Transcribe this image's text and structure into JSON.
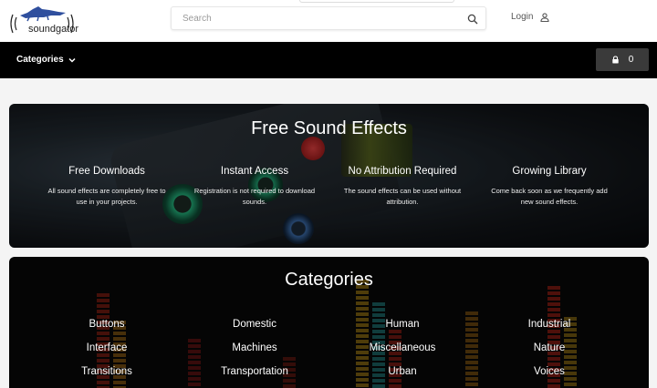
{
  "header": {
    "logo_text": "soundgator",
    "search_placeholder": "Search",
    "login_label": "Login"
  },
  "nav": {
    "categories_label": "Categories",
    "cart_count": "0"
  },
  "hero": {
    "title": "Free Sound Effects",
    "features": [
      {
        "title": "Free Downloads",
        "desc": "All sound effects are completely free to use in your projects."
      },
      {
        "title": "Instant Access",
        "desc": "Registration is not required to download sounds."
      },
      {
        "title": "No Attribution Required",
        "desc": "The sound effects can be used without attribution."
      },
      {
        "title": "Growing Library",
        "desc": "Come back soon as we frequently add new sound effects."
      }
    ]
  },
  "categories": {
    "title": "Categories",
    "items": [
      "Buttons",
      "Domestic",
      "Human",
      "Industrial",
      "Interface",
      "Machines",
      "Miscellaneous",
      "Nature",
      "Transitions",
      "Transportation",
      "Urban",
      "Voices"
    ]
  },
  "colors": {
    "navbar": "#000000",
    "cart_button": "#3a3a3a",
    "logo_blue": "#2f4f9e"
  },
  "icons": {
    "logo": "gator-logo-icon",
    "search": "magnifier-icon",
    "login": "user-icon",
    "nav_chevron": "chevron-down-icon",
    "cart": "lock-bag-icon"
  }
}
